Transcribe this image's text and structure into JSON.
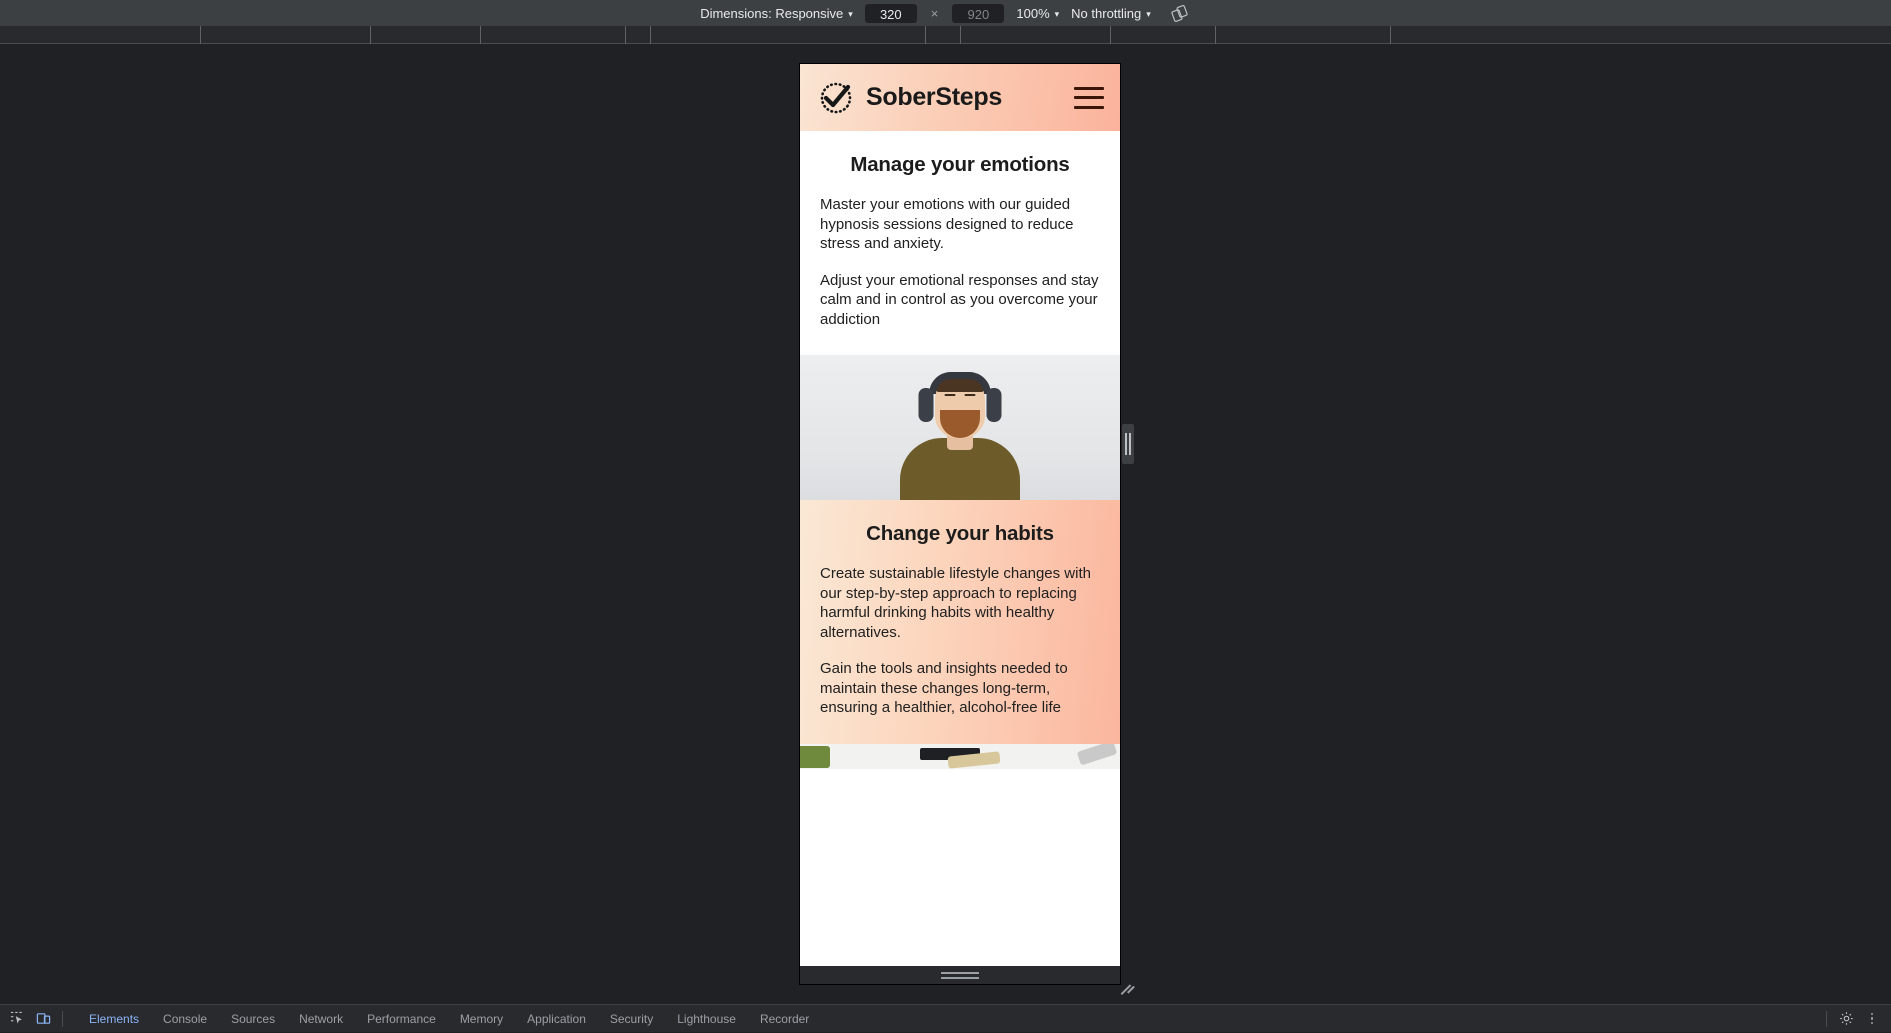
{
  "device_toolbar": {
    "dimensions_label": "Dimensions: Responsive",
    "width_value": "320",
    "height_placeholder": "920",
    "multiply_symbol": "×",
    "zoom_label": "100%",
    "throttling_label": "No throttling",
    "rotate_icon": "rotate-device-icon",
    "caret": "▾"
  },
  "site": {
    "brand": "SoberSteps",
    "logo_icon": "checkmark-dotted-circle-icon",
    "menu_icon": "hamburger-menu-icon",
    "sections": [
      {
        "id": "manage-emotions",
        "heading": "Manage your emotions",
        "paragraphs": [
          "Master your emotions with our guided hypnosis sessions designed to reduce stress and anxiety.",
          "Adjust your emotional responses and stay calm and in control as you overcome your addiction"
        ]
      },
      {
        "id": "change-habits",
        "heading": "Change your habits",
        "paragraphs": [
          "Create sustainable lifestyle changes with our step-by-step approach to replacing harmful drinking habits with healthy alternatives.",
          "Gain the tools and insights needed to maintain these changes long-term, ensuring a healthier, alcohol-free life"
        ]
      }
    ],
    "images": [
      {
        "id": "hero-headphones",
        "alt": "Man with headphones, eyes closed, relaxing against a light wall"
      },
      {
        "id": "secondary-photo",
        "alt": "Partially visible photo of items on a white surface"
      }
    ]
  },
  "devtools": {
    "inspect_icon": "inspect-element-icon",
    "device_toggle_icon": "toggle-device-toolbar-icon",
    "settings_icon": "gear-icon",
    "more_icon": "more-vertical-icon",
    "tabs": [
      {
        "label": "Elements",
        "active": true
      },
      {
        "label": "Console",
        "active": false
      },
      {
        "label": "Sources",
        "active": false
      },
      {
        "label": "Network",
        "active": false
      },
      {
        "label": "Performance",
        "active": false
      },
      {
        "label": "Memory",
        "active": false
      },
      {
        "label": "Application",
        "active": false
      },
      {
        "label": "Security",
        "active": false
      },
      {
        "label": "Lighthouse",
        "active": false
      },
      {
        "label": "Recorder",
        "active": false
      }
    ]
  },
  "colors": {
    "accent_blue": "#8ab4f8",
    "toolbar_bg": "#3c4043",
    "panel_bg": "#292a2d",
    "stage_bg": "#202124",
    "peach_light": "#fae8d5",
    "peach_dark": "#fbb39c",
    "menu_dark": "#3a1508"
  },
  "ruler_ticks": [
    200,
    370,
    480,
    625,
    650,
    925,
    960,
    1110,
    1215,
    1390
  ]
}
